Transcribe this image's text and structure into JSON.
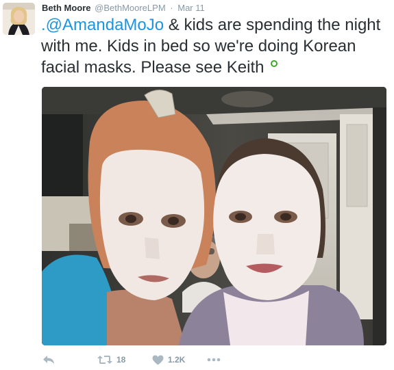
{
  "tweet": {
    "author": {
      "display_name": "Beth Moore",
      "handle": "@BethMooreLPM"
    },
    "separator": "·",
    "timestamp": "Mar 11",
    "text": {
      "mention": ".@AmandaMoJo",
      "body": " & kids are spending the night with me. Kids in bed so we're doing Korean facial masks. Please see Keith"
    },
    "photo_alt": "Two women wearing white sheet facial masks taking a selfie, a man photobombing in the background",
    "actions": {
      "retweet_count": "18",
      "like_count": "1.2K"
    }
  },
  "colors": {
    "link": "#1b95e0",
    "text": "#292f33",
    "meta": "#8899a6",
    "media_indicator": "#3fa32b"
  },
  "icons": [
    "reply-icon",
    "retweet-icon",
    "heart-icon",
    "more-icon"
  ]
}
